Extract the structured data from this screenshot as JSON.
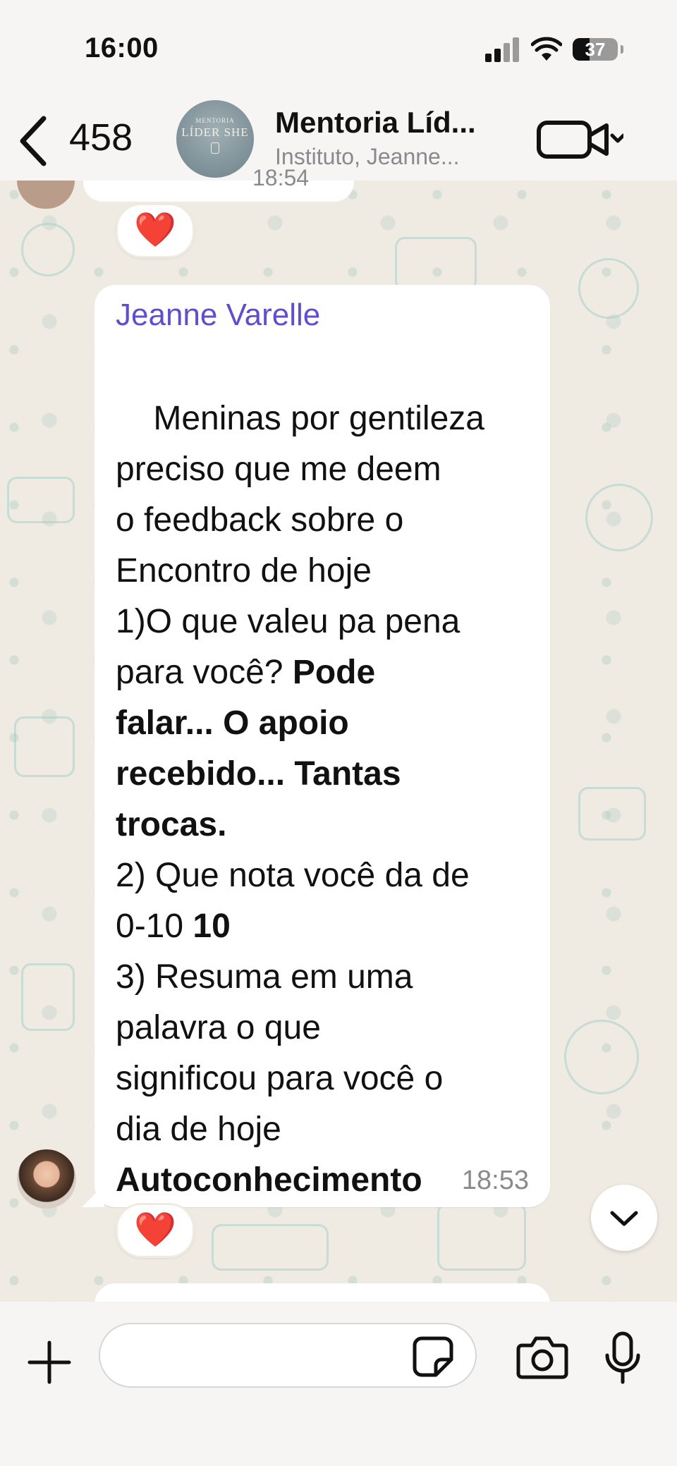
{
  "status_bar": {
    "time": "16:00",
    "battery": "37",
    "icons": [
      "cellular-signal-icon",
      "wifi-icon",
      "battery-icon"
    ]
  },
  "header": {
    "back_count": "458",
    "group_name": "Mentoria Líd...",
    "group_subtitle": "Instituto, Jeanne...",
    "avatar_text_small": "MENTORIA",
    "avatar_text_big": "LÍDER SHE",
    "icons": [
      "chevron-left-icon",
      "video-camera-icon",
      "chevron-down-icon"
    ]
  },
  "previous_message": {
    "time_partial": "18:54",
    "reaction": "❤️"
  },
  "message": {
    "sender": "Jeanne Varelle",
    "time": "18:53",
    "reaction": "❤️",
    "segments": [
      {
        "text": "Meninas por gentileza\npreciso que me deem\no feedback sobre o\nEncontro de hoje\n1)O que valeu pa pena\npara você? ",
        "bold": false
      },
      {
        "text": "Pode\nfalar... O apoio\nrecebido... Tantas\ntrocas.",
        "bold": true
      },
      {
        "text": "\n2) Que nota você da de\n0-10 ",
        "bold": false
      },
      {
        "text": "10",
        "bold": true
      },
      {
        "text": "\n3) Resuma em uma\npalavra o que\nsignificou para você o\ndia de hoje\n",
        "bold": false
      },
      {
        "text": "Autoconhecimento",
        "bold": true
      }
    ]
  },
  "input": {
    "placeholder": "",
    "icons": [
      "plus-icon",
      "sticker-icon",
      "camera-icon",
      "microphone-icon"
    ]
  },
  "colors": {
    "sender_name": "#5e4fcf",
    "chat_background": "#efeae2",
    "bubble": "#ffffff",
    "reaction_heart": "#e0202e"
  }
}
